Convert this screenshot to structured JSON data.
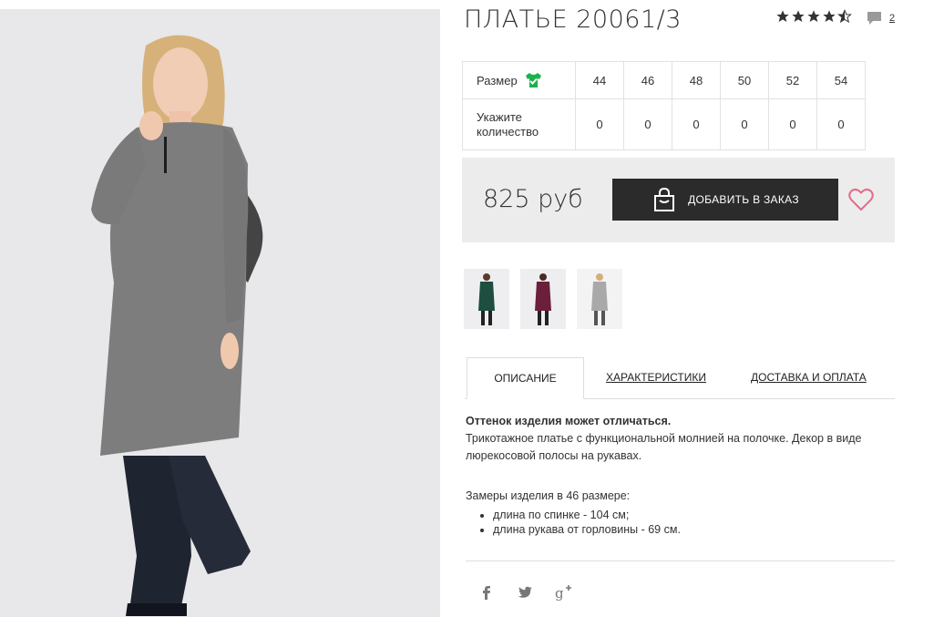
{
  "product": {
    "title": "ПЛАТЬЕ 20061/3",
    "rating": 4.5,
    "comments_count": "2",
    "price": "825 руб",
    "add_to_order_label": "ДОБАВИТЬ В ЗАКАЗ"
  },
  "size_table": {
    "size_label": "Размер",
    "qty_label": "Укажите количество",
    "sizes": [
      "44",
      "46",
      "48",
      "50",
      "52",
      "54"
    ],
    "quantities": [
      "0",
      "0",
      "0",
      "0",
      "0",
      "0"
    ]
  },
  "thumbnails": [
    {
      "icon": "dress-thumbnail-green"
    },
    {
      "icon": "dress-thumbnail-burgundy"
    },
    {
      "icon": "dress-thumbnail-grey"
    }
  ],
  "tabs": [
    "ОПИСАНИЕ",
    "ХАРАКТЕРИСТИКИ",
    "ДОСТАВКА И ОПЛАТА"
  ],
  "description": {
    "note": "Оттенок изделия может отличаться.",
    "text": "Трикотажное платье с функциональной молнией на полочке. Декор в виде люрекосовой полосы на рукавах.",
    "measurements_title": "Замеры изделия в 46 размере:",
    "measurements": [
      "длина по спинке - 104 см;",
      "длина рукава от горловины - 69 см."
    ]
  },
  "social": [
    "facebook-icon",
    "twitter-icon",
    "google-plus-icon"
  ],
  "colors": {
    "button_bg": "#2b2b2b",
    "heart": "#e36b87",
    "size_check": "#19b34b",
    "buybox_bg": "#ececec"
  }
}
